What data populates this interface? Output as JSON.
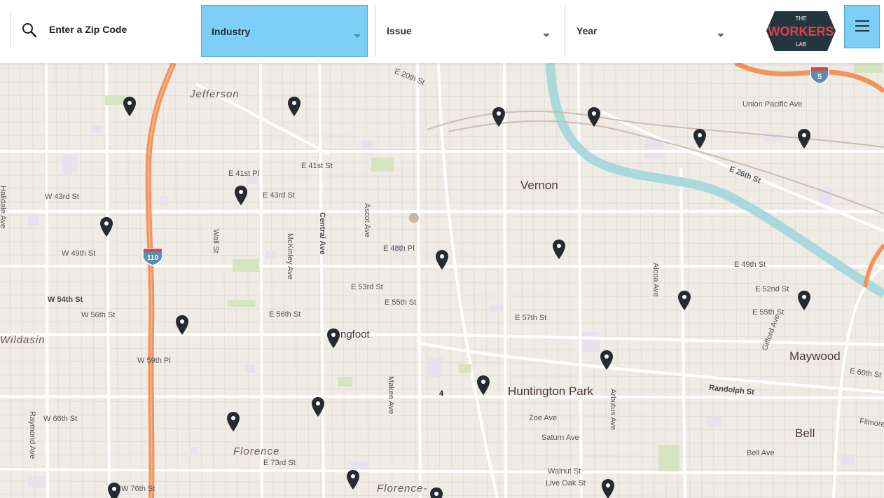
{
  "search": {
    "placeholder": "Enter a Zip Code"
  },
  "filters": [
    {
      "label": "Industry",
      "active": true
    },
    {
      "label": "Issue",
      "active": false
    },
    {
      "label": "Year",
      "active": false
    }
  ],
  "logo": {
    "line1": "THE",
    "line2": "WORKERS",
    "line3": "LAB"
  },
  "colors": {
    "accent": "#7dcff8",
    "logo_bg": "#253540",
    "logo_text": "#e3414a",
    "map_bg": "#efebe5",
    "freeway": "#f2935c",
    "river": "#a9d8dd",
    "pin": "#262b31"
  },
  "map": {
    "places": [
      "Jefferson",
      "Vernon",
      "Huntington Park",
      "Maywood",
      "Bell",
      "Florence",
      "Florence-",
      "Wildasin",
      "ngfoot"
    ],
    "streets": [
      "E 20th St",
      "Union Pacific Ave",
      "E 26th St",
      "E 41st Pl",
      "E 41st St",
      "E 43rd St",
      "W 43rd St",
      "W 49th St",
      "W 54th St",
      "W 56th St",
      "E 56th St",
      "E 53rd St",
      "E 55th St",
      "E 48th Pl",
      "E 57th St",
      "E 49th St",
      "E 52nd St",
      "E 55th St",
      "W 59th Pl",
      "W 66th St",
      "E 73rd St",
      "W 76th St",
      "Zoe Ave",
      "Saturn Ave",
      "Walnut St",
      "Live Oak St",
      "Bell Ave",
      "Randolph St",
      "E 60th St",
      "Filmore",
      "Central Ave",
      "Ascot Ave",
      "Wall St",
      "McKinley Ave",
      "Makee Ave",
      "Alcoa Ave",
      "Arbutus Ave",
      "Gifford Ave",
      "Raymond Ave",
      "Halldale Ave"
    ],
    "shields": [
      "110",
      "5"
    ],
    "cluster_label": "4",
    "pin_count": 26
  }
}
